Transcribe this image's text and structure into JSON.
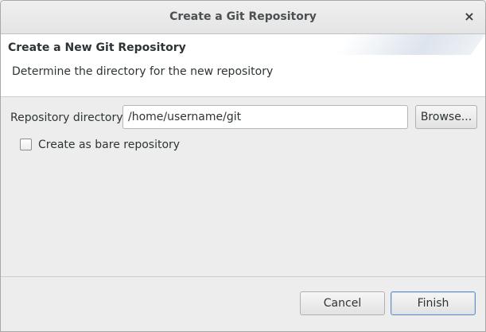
{
  "window": {
    "title": "Create a Git Repository",
    "close_glyph": "×"
  },
  "banner": {
    "title": "Create a New Git Repository",
    "description": "Determine the directory for the new repository"
  },
  "form": {
    "directory_label": "Repository directory:",
    "directory_value": "/home/username/git",
    "browse_label": "Browse...",
    "bare_label": "Create as bare repository",
    "bare_checked": false
  },
  "footer": {
    "cancel_label": "Cancel",
    "finish_label": "Finish"
  },
  "colors": {
    "window_bg": "#ededed",
    "banner_bg": "#ffffff",
    "default_button_border": "#6a8dbf"
  },
  "icons": {
    "close": "close-icon"
  }
}
